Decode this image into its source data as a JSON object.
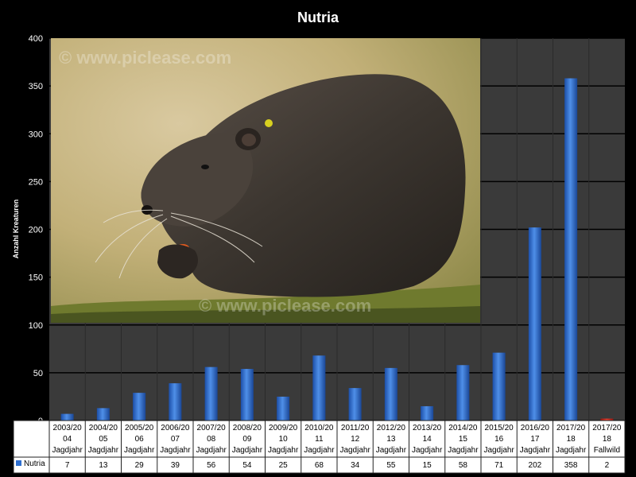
{
  "chart_data": {
    "type": "bar",
    "title": "Nutria",
    "ylabel": "Anzahl Kreaturen",
    "xlabel": "",
    "ylim": [
      0,
      400
    ],
    "yticks": [
      0,
      50,
      100,
      150,
      200,
      250,
      300,
      350,
      400
    ],
    "grid": true,
    "legend_position": "bottom-left (data table)",
    "categories": [
      {
        "line1": "2003/20",
        "line2": "04",
        "line3": "Jagdjahr"
      },
      {
        "line1": "2004/20",
        "line2": "05",
        "line3": "Jagdjahr"
      },
      {
        "line1": "2005/20",
        "line2": "06",
        "line3": "Jagdjahr"
      },
      {
        "line1": "2006/20",
        "line2": "07",
        "line3": "Jagdjahr"
      },
      {
        "line1": "2007/20",
        "line2": "08",
        "line3": "Jagdjahr"
      },
      {
        "line1": "2008/20",
        "line2": "09",
        "line3": "Jagdjahr"
      },
      {
        "line1": "2009/20",
        "line2": "10",
        "line3": "Jagdjahr"
      },
      {
        "line1": "2010/20",
        "line2": "11",
        "line3": "Jagdjahr"
      },
      {
        "line1": "2011/20",
        "line2": "12",
        "line3": "Jagdjahr"
      },
      {
        "line1": "2012/20",
        "line2": "13",
        "line3": "Jagdjahr"
      },
      {
        "line1": "2013/20",
        "line2": "14",
        "line3": "Jagdjahr"
      },
      {
        "line1": "2014/20",
        "line2": "15",
        "line3": "Jagdjahr"
      },
      {
        "line1": "2015/20",
        "line2": "16",
        "line3": "Jagdjahr"
      },
      {
        "line1": "2016/20",
        "line2": "17",
        "line3": "Jagdjahr"
      },
      {
        "line1": "2017/20",
        "line2": "18",
        "line3": "Jagdjahr"
      },
      {
        "line1": "2017/20",
        "line2": "18",
        "line3": "Fallwild"
      }
    ],
    "series": [
      {
        "name": "Nutria",
        "values": [
          7,
          13,
          29,
          39,
          56,
          54,
          25,
          68,
          34,
          55,
          15,
          58,
          71,
          202,
          358,
          2
        ],
        "value_labels": [
          "7",
          "13",
          "29",
          "39",
          "56",
          "54",
          "25",
          "68",
          "34",
          "55",
          "15",
          "58",
          "71",
          "202",
          "358",
          "2"
        ],
        "color": "#2e6fd0",
        "highlight_color": "#e03020",
        "highlight_index": 15
      }
    ],
    "colors": {
      "background": "#000000",
      "plot_background": "#3a3a3a",
      "gridline": "#000000",
      "text": "#ffffff"
    }
  },
  "photo": {
    "watermark": "© www.piclease.com",
    "watermark_bottom": "© www.piclease.com"
  }
}
